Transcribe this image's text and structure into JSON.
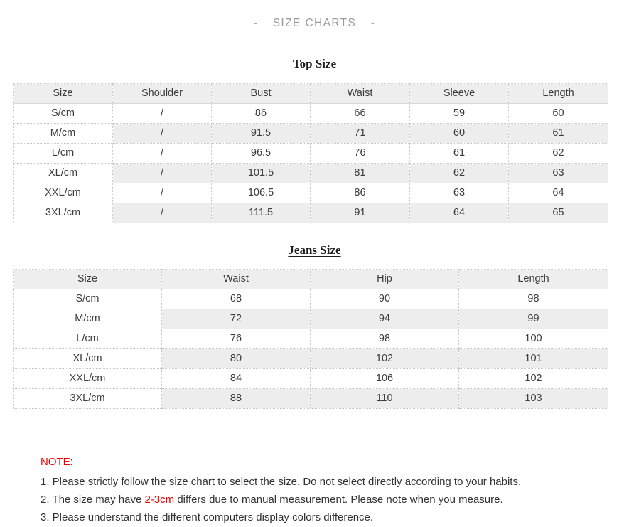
{
  "header": {
    "left_dash": "-",
    "title": "SIZE CHARTS",
    "right_dash": "-"
  },
  "top_chart": {
    "title": "Top Size",
    "columns": [
      "Size",
      "Shoulder",
      "Bust",
      "Waist",
      "Sleeve",
      "Length"
    ],
    "rows": [
      [
        "S/cm",
        "/",
        "86",
        "66",
        "59",
        "60"
      ],
      [
        "M/cm",
        "/",
        "91.5",
        "71",
        "60",
        "61"
      ],
      [
        "L/cm",
        "/",
        "96.5",
        "76",
        "61",
        "62"
      ],
      [
        "XL/cm",
        "/",
        "101.5",
        "81",
        "62",
        "63"
      ],
      [
        "XXL/cm",
        "/",
        "106.5",
        "86",
        "63",
        "64"
      ],
      [
        "3XL/cm",
        "/",
        "111.5",
        "91",
        "64",
        "65"
      ]
    ]
  },
  "jeans_chart": {
    "title": "Jeans Size",
    "columns": [
      "Size",
      "Waist",
      "Hip",
      "Length"
    ],
    "rows": [
      [
        "S/cm",
        "68",
        "90",
        "98"
      ],
      [
        "M/cm",
        "72",
        "94",
        "99"
      ],
      [
        "L/cm",
        "76",
        "98",
        "100"
      ],
      [
        "XL/cm",
        "80",
        "102",
        "101"
      ],
      [
        "XXL/cm",
        "84",
        "106",
        "102"
      ],
      [
        "3XL/cm",
        "88",
        "110",
        "103"
      ]
    ]
  },
  "note": {
    "heading": "NOTE:",
    "line1": "1. Please strictly follow the size chart  to select the size. Do not select directly according to your habits.",
    "line2_part1": "2. The size may have ",
    "line2_highlight": "2-3cm",
    "line2_part2": " differs due to manual measurement. Please note when you measure.",
    "line3": "3. Please understand the different computers display colors difference."
  },
  "colors": {
    "accent_red": "#ee0000",
    "header_gray": "#9a9a9a",
    "row_alt": "#ededed",
    "header_row": "#eeeeee"
  }
}
